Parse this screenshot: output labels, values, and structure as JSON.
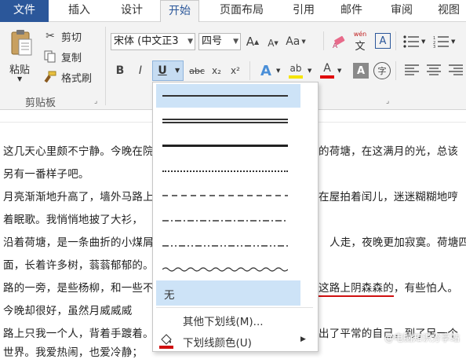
{
  "tabs": [
    {
      "label": "文件"
    },
    {
      "label": "插入"
    },
    {
      "label": "设计"
    },
    {
      "label": "开始"
    },
    {
      "label": "页面布局"
    },
    {
      "label": "引用"
    },
    {
      "label": "邮件"
    },
    {
      "label": "审阅"
    },
    {
      "label": "视图"
    }
  ],
  "clipboard": {
    "paste": "粘贴",
    "cut": "剪切",
    "copy": "复制",
    "format_painter": "格式刷",
    "group_label": "剪贴板"
  },
  "font": {
    "name": "宋体 (中文正3",
    "size": "四号",
    "bold": "B",
    "italic": "I",
    "underline": "U",
    "strike": "abc",
    "sub": "x₂",
    "sup": "x²",
    "grow": "A",
    "shrink": "A",
    "aa": "Aa",
    "pinyin": "wén",
    "highlight_color": "#f5e400",
    "font_color": "#e00000",
    "underline_color": "#d01010"
  },
  "menu": {
    "none_label": "无",
    "more": "其他下划线(M)...",
    "color": "下划线颜色(U)"
  },
  "document": {
    "lines": [
      {
        "a": "这几天心里颇不宁静。今晚在院",
        "b": "的荷塘，在这满月的光，总该"
      },
      {
        "a": "另有一番样子吧。",
        "b": ""
      },
      {
        "a": "月亮渐渐地升高了，墙外马路上",
        "b": "在屋拍着闰儿，迷迷糊糊地哼"
      },
      {
        "a": "着眠歌。我悄悄地披了大衫，",
        "b": ""
      },
      {
        "a": "沿着荷塘，是一条曲折的小煤屑",
        "b": "人走，夜晚更加寂寞。荷塘四"
      },
      {
        "a": "面，长着许多树，蓊蓊郁郁的。",
        "b": ""
      },
      {
        "a": "路的一旁，是些杨柳，和一些不",
        "b_under": "这路上阴森森的",
        "b": "，有些怕人。"
      },
      {
        "a": "今晚却很好，虽然月威威威",
        "b": ""
      },
      {
        "a": "路上只我一个人，背着手踱着。",
        "b": "出了平常的自己，到了另一个"
      },
      {
        "a": "世界。我爱热闹，也爱冷静；",
        "b": ""
      }
    ]
  },
  "watermark": "@电脑知识分享站"
}
